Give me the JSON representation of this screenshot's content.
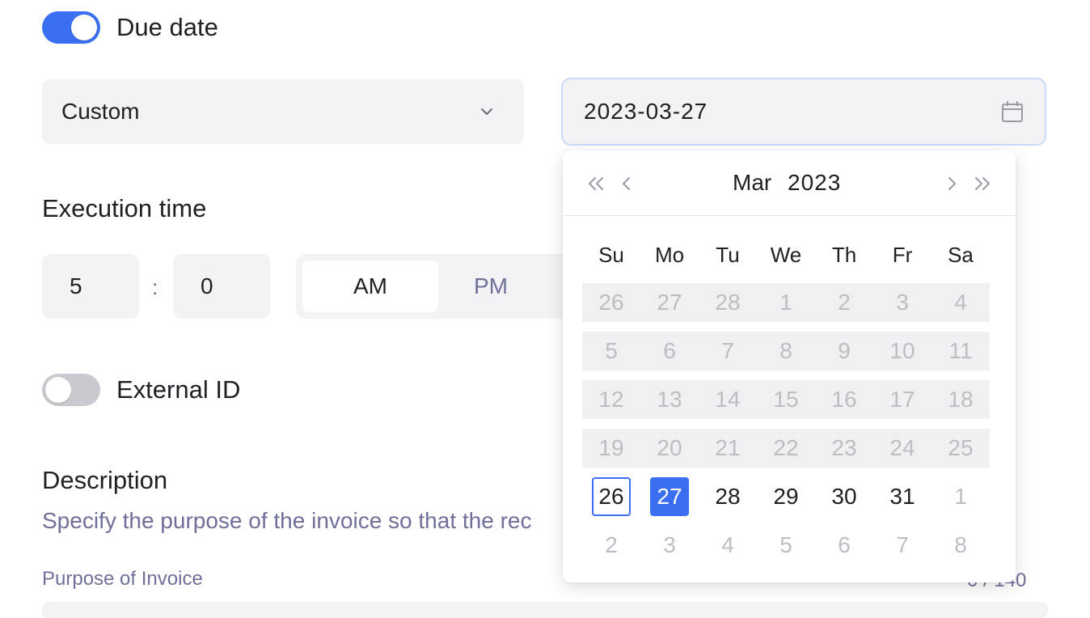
{
  "due_date": {
    "label": "Due date",
    "enabled": true
  },
  "due_select": {
    "value": "Custom",
    "icon": "chevron-down-icon"
  },
  "date_input": {
    "value": "2023-03-27",
    "icon": "calendar-icon"
  },
  "execution_time": {
    "heading": "Execution time",
    "hour": "5",
    "separator": ":",
    "minute": "0",
    "am_label": "AM",
    "pm_label": "PM",
    "selected_period": "AM"
  },
  "external_id": {
    "label": "External ID",
    "enabled": false
  },
  "description": {
    "heading": "Description",
    "subtitle": "Specify the purpose of the invoice so that the rec",
    "purpose_label": "Purpose of Invoice",
    "counter": "0 / 140"
  },
  "calendar": {
    "month": "Mar",
    "year": "2023",
    "weekdays": [
      "Su",
      "Mo",
      "Tu",
      "We",
      "Th",
      "Fr",
      "Sa"
    ],
    "weeks": [
      [
        "26",
        "27",
        "28",
        "1",
        "2",
        "3",
        "4"
      ],
      [
        "5",
        "6",
        "7",
        "8",
        "9",
        "10",
        "11"
      ],
      [
        "12",
        "13",
        "14",
        "15",
        "16",
        "17",
        "18"
      ],
      [
        "19",
        "20",
        "21",
        "22",
        "23",
        "24",
        "25"
      ],
      [
        "26",
        "27",
        "28",
        "29",
        "30",
        "31",
        "1"
      ],
      [
        "2",
        "3",
        "4",
        "5",
        "6",
        "7",
        "8"
      ]
    ],
    "today": "26",
    "selected": "27",
    "accent_color": "#3a6ff2"
  }
}
